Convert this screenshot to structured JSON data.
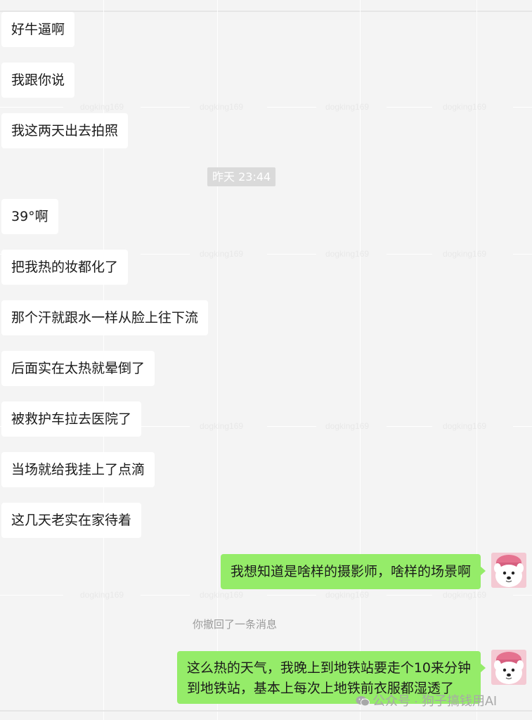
{
  "incoming_messages": [
    {
      "text": "好牛逼啊"
    },
    {
      "text": "我跟你说"
    },
    {
      "text": "我这两天出去拍照"
    },
    {
      "text": "39°啊"
    },
    {
      "text": "把我热的妆都化了"
    },
    {
      "text": "那个汗就跟水一样从脸上往下流"
    },
    {
      "text": "后面实在太热就晕倒了"
    },
    {
      "text": "被救护车拉去医院了"
    },
    {
      "text": "当场就给我挂上了点滴"
    },
    {
      "text": "这几天老实在家待着"
    }
  ],
  "timestamp": "昨天 23:44",
  "outgoing_messages": [
    {
      "lines": [
        "我想知道是啥样的摄影师，啥样的场景啊"
      ]
    },
    {
      "lines": [
        "这么热的天气，我晚上到地铁站要走个10来分钟",
        "到地铁站，基本上每次上地铁前衣服都湿透了"
      ]
    }
  ],
  "system_note": "你撤回了一条消息",
  "watermark_text": "dogking169",
  "footer_watermark": "公众号 · 狗子搞钱用AI",
  "colors": {
    "background": "#f4f4f4",
    "incoming_bubble": "#ffffff",
    "outgoing_bubble": "#95ec69",
    "timestamp_bg": "#dadada"
  },
  "icons": {
    "avatar": "samoyed-dog-pink-hat-avatar",
    "footer": "wechat-logo-icon"
  }
}
